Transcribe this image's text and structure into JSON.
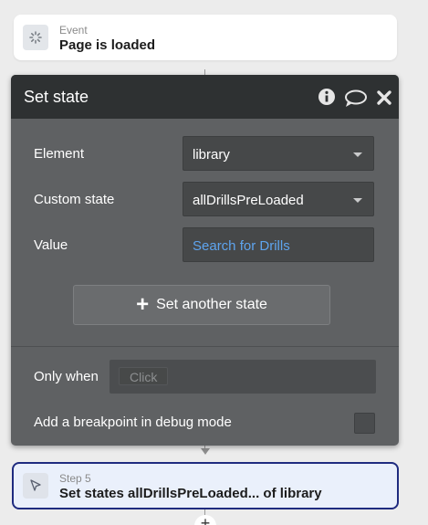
{
  "event": {
    "kind": "Event",
    "title": "Page is loaded"
  },
  "panel": {
    "title": "Set state",
    "header_icons": [
      "info-icon",
      "comment-icon",
      "close-icon"
    ],
    "element": {
      "label": "Element",
      "value": "library"
    },
    "custom_state": {
      "label": "Custom state",
      "value": "allDrillsPreLoaded"
    },
    "value_field": {
      "label": "Value",
      "value": "Search for Drills"
    },
    "add_state_button": "Set another state",
    "only_when": {
      "label": "Only when",
      "placeholder": "Click"
    },
    "breakpoint": {
      "label": "Add a breakpoint in debug mode",
      "checked": false
    }
  },
  "step": {
    "kind": "Step 5",
    "title": "Set states allDrillsPreLoaded... of library"
  },
  "colors": {
    "panel_bg": "#5f6163",
    "panel_header": "#2e3132",
    "dynamic_text": "#5ea4ee",
    "step_border": "#1f2b7f",
    "step_bg": "#eaf0fb"
  }
}
